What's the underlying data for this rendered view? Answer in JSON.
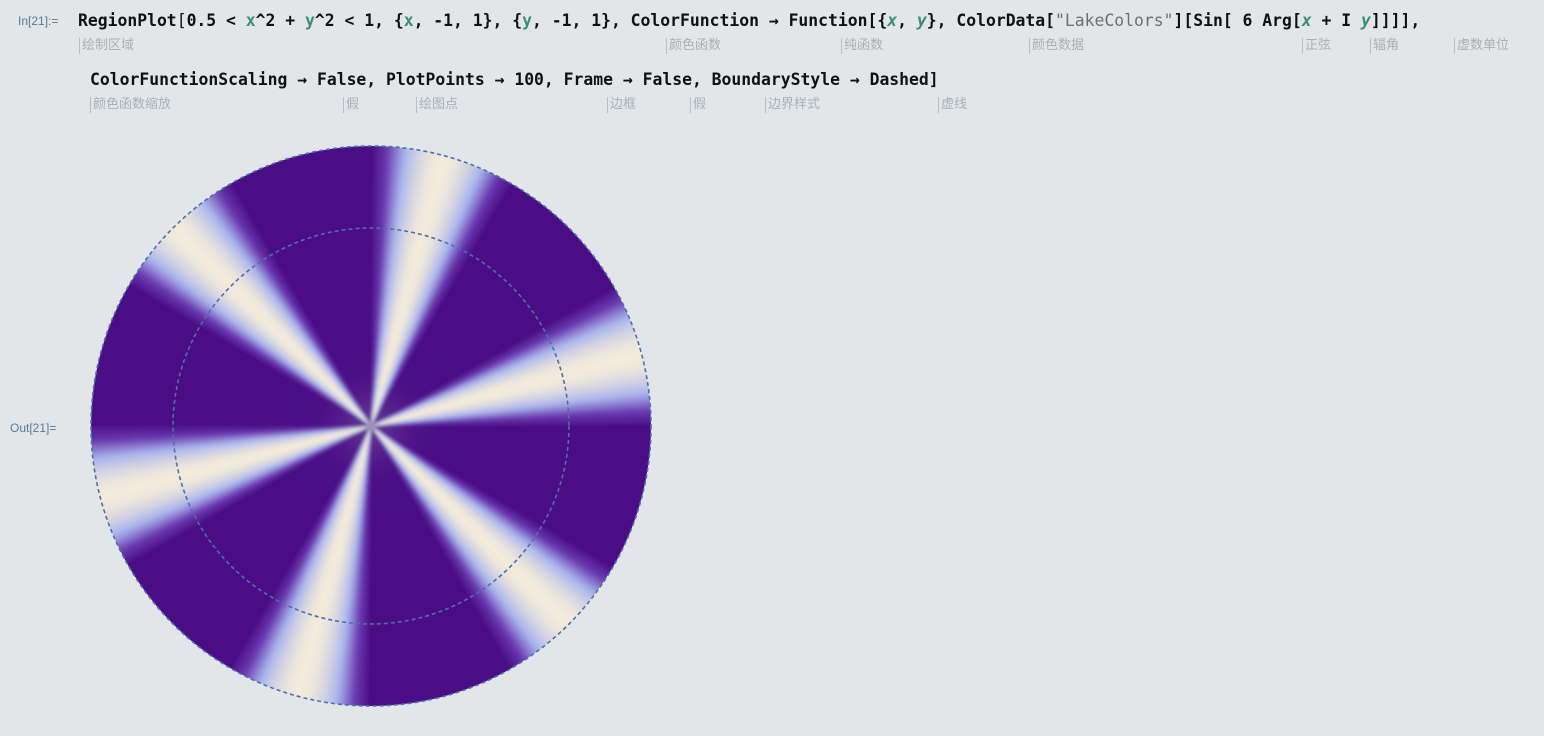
{
  "input_label": "In[21]:=",
  "output_label": "Out[21]=",
  "code": {
    "line1": [
      {
        "t": "RegionPlot",
        "c": ""
      },
      {
        "t": "[",
        "c": "op"
      },
      {
        "t": "0.5 < ",
        "c": ""
      },
      {
        "t": "x",
        "c": "var"
      },
      {
        "t": "^2 + ",
        "c": ""
      },
      {
        "t": "y",
        "c": "var"
      },
      {
        "t": "^2 < 1, {",
        "c": ""
      },
      {
        "t": "x",
        "c": "var"
      },
      {
        "t": ", -1, 1}, {",
        "c": ""
      },
      {
        "t": "y",
        "c": "var"
      },
      {
        "t": ", -1, 1}, ColorFunction → Function[{",
        "c": ""
      },
      {
        "t": "x",
        "c": "ivar"
      },
      {
        "t": ", ",
        "c": ""
      },
      {
        "t": "y",
        "c": "ivar"
      },
      {
        "t": "}, ColorData[",
        "c": ""
      },
      {
        "t": "\"LakeColors\"",
        "c": "str"
      },
      {
        "t": "][Sin[ 6 Arg[",
        "c": ""
      },
      {
        "t": "x",
        "c": "ivar"
      },
      {
        "t": " + I ",
        "c": ""
      },
      {
        "t": "y",
        "c": "ivar"
      },
      {
        "t": "]]]],",
        "c": ""
      }
    ],
    "line2": [
      {
        "t": "ColorFunctionScaling → False, PlotPoints → 100, Frame → False, BoundaryStyle → Dashed]",
        "c": ""
      }
    ]
  },
  "hints": {
    "line1": [
      "绘制区域",
      "颜色函数",
      "纯函数",
      "颜色数据",
      "正弦",
      "辐角",
      "虚数单位"
    ],
    "line2": [
      "颜色函数缩放",
      "假",
      "绘图点",
      "边框",
      "假",
      "边界样式",
      "虚线"
    ]
  },
  "plot": {
    "type": "RegionPlot",
    "region": "0.5 < x^2 + y^2 < 1",
    "x_range": [
      -1,
      1
    ],
    "y_range": [
      -1,
      1
    ],
    "color_scheme": "LakeColors",
    "color_stops": [
      "#4b0f86",
      "#6a3ab0",
      "#a9b4ec",
      "#f2eadb"
    ],
    "boundary_style": "dashed",
    "boundary_color": "#4f6fa8",
    "frequency": 6
  }
}
